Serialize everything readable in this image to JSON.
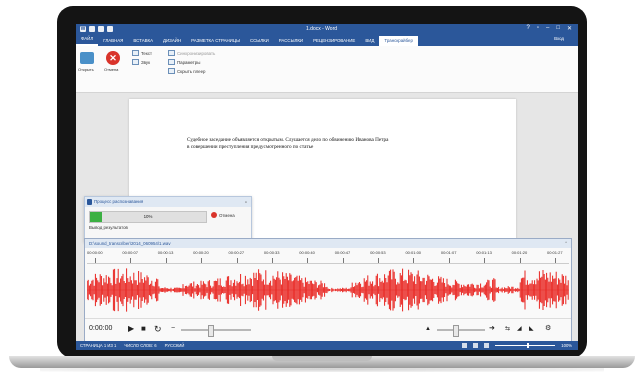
{
  "window": {
    "title": "1.docx - Word",
    "controls": [
      "?",
      "▫",
      "–",
      "□",
      "✕"
    ]
  },
  "tabs": [
    {
      "label": "ФАЙЛ"
    },
    {
      "label": "ГЛАВНАЯ"
    },
    {
      "label": "ВСТАВКА"
    },
    {
      "label": "ДИЗАЙН"
    },
    {
      "label": "РАЗМЕТКА СТРАНИЦЫ"
    },
    {
      "label": "ССЫЛКИ"
    },
    {
      "label": "РАССЫЛКИ"
    },
    {
      "label": "РЕЦЕНЗИРОВАНИЕ"
    },
    {
      "label": "ВИД"
    },
    {
      "label": "Транскрайбер"
    }
  ],
  "login_label": "Вход",
  "ribbon": {
    "open_label": "Открыть",
    "cancel_label": "Отмена",
    "col1": [
      "Текст",
      "Звук"
    ],
    "col2": [
      "Синхронизировать",
      "Параметры",
      "Скрыть плеер"
    ]
  },
  "document": {
    "line1": "Судебное заседание объявляется открытым. Слушается дело по обвинению Иванова Петра",
    "line2": "в совершении преступления предусмотренного по статье"
  },
  "progress": {
    "title": "Процесс распознавания",
    "percent_label": "10%",
    "fraction": 0.1,
    "cancel_label": "Отмена",
    "status": "Вывод результатов"
  },
  "player": {
    "filename": "D:\\sound_transcriber\\2014_060954\\1.wav",
    "ticks": [
      "00:00:00",
      "00:00:07",
      "00:00:13",
      "00:00:20",
      "00:00:27",
      "00:00:33",
      "00:00:40",
      "00:00:47",
      "00:00:53",
      "00:01:00",
      "00:01:07",
      "00:01:13",
      "00:01:20",
      "00:01:27"
    ],
    "time": "0:00:00",
    "position_fraction": 0.0,
    "speed_fraction": 0.55,
    "volume_fraction": 0.05,
    "wave_color": "#e8231f"
  },
  "statusbar": {
    "page": "СТРАНИЦА 1 ИЗ 1",
    "words": "ЧИСЛО СЛОВ: 6",
    "lang": "РУССКИЙ",
    "zoom": "100%"
  }
}
